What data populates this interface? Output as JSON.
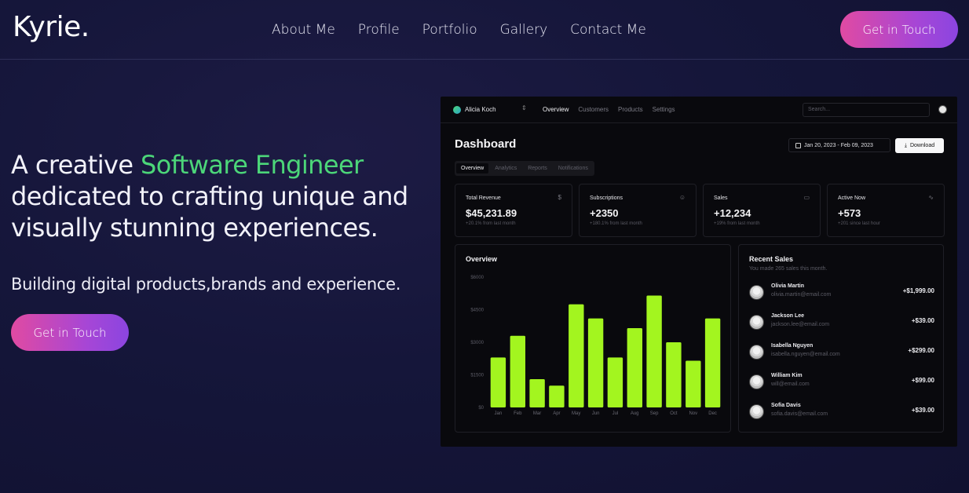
{
  "site": {
    "logo": "Kyrie.",
    "nav": [
      "About Me",
      "Profile",
      "Portfolio",
      "Gallery",
      "Contact Me"
    ],
    "cta_label": "Get in Touch"
  },
  "hero": {
    "title_prefix": "A creative ",
    "title_accent": "Software Engineer",
    "title_rest": "dedicated to crafting unique and visually stunning experiences.",
    "subtitle": "Building digital products,brands and experience.",
    "cta_label": "Get in Touch",
    "accent_color": "#4cd679"
  },
  "dashboard": {
    "account_name": "Alicia Koch",
    "nav": [
      {
        "label": "Overview",
        "active": true
      },
      {
        "label": "Customers",
        "active": false
      },
      {
        "label": "Products",
        "active": false
      },
      {
        "label": "Settings",
        "active": false
      }
    ],
    "search_placeholder": "Search...",
    "title": "Dashboard",
    "date_range": "Jan 20, 2023 - Feb 09, 2023",
    "download_label": "Download",
    "tabs": [
      {
        "label": "Overview",
        "active": true
      },
      {
        "label": "Analytics",
        "active": false
      },
      {
        "label": "Reports",
        "active": false
      },
      {
        "label": "Notifications",
        "active": false
      }
    ],
    "kpis": [
      {
        "label": "Total Revenue",
        "value": "$45,231.89",
        "note": "+20.1% from last month",
        "icon": "dollar-icon"
      },
      {
        "label": "Subscriptions",
        "value": "+2350",
        "note": "+180.1% from last month",
        "icon": "users-icon"
      },
      {
        "label": "Sales",
        "value": "+12,234",
        "note": "+19% from last month",
        "icon": "credit-card-icon"
      },
      {
        "label": "Active Now",
        "value": "+573",
        "note": "+201 since last hour",
        "icon": "activity-icon"
      }
    ],
    "overview_title": "Overview",
    "recent_sales": {
      "title": "Recent Sales",
      "subtitle": "You made 265 sales this month.",
      "items": [
        {
          "name": "Olivia Martin",
          "email": "olivia.martin@email.com",
          "amount": "+$1,999.00"
        },
        {
          "name": "Jackson Lee",
          "email": "jackson.lee@email.com",
          "amount": "+$39.00"
        },
        {
          "name": "Isabella Nguyen",
          "email": "isabella.nguyen@email.com",
          "amount": "+$299.00"
        },
        {
          "name": "William Kim",
          "email": "will@email.com",
          "amount": "+$99.00"
        },
        {
          "name": "Sofia Davis",
          "email": "sofia.davis@email.com",
          "amount": "+$39.00"
        }
      ]
    }
  },
  "chart_data": {
    "type": "bar",
    "categories": [
      "Jan",
      "Feb",
      "Mar",
      "Apr",
      "May",
      "Jun",
      "Jul",
      "Aug",
      "Sep",
      "Oct",
      "Nov",
      "Dec"
    ],
    "values": [
      2300,
      3300,
      1300,
      1000,
      4750,
      4100,
      2300,
      3650,
      5150,
      3000,
      2150,
      4100
    ],
    "yticks": [
      "$0",
      "$1500",
      "$3000",
      "$4500",
      "$6000"
    ],
    "ylim": [
      0,
      6000
    ],
    "bar_color": "#a3f51f",
    "title": "Overview"
  }
}
